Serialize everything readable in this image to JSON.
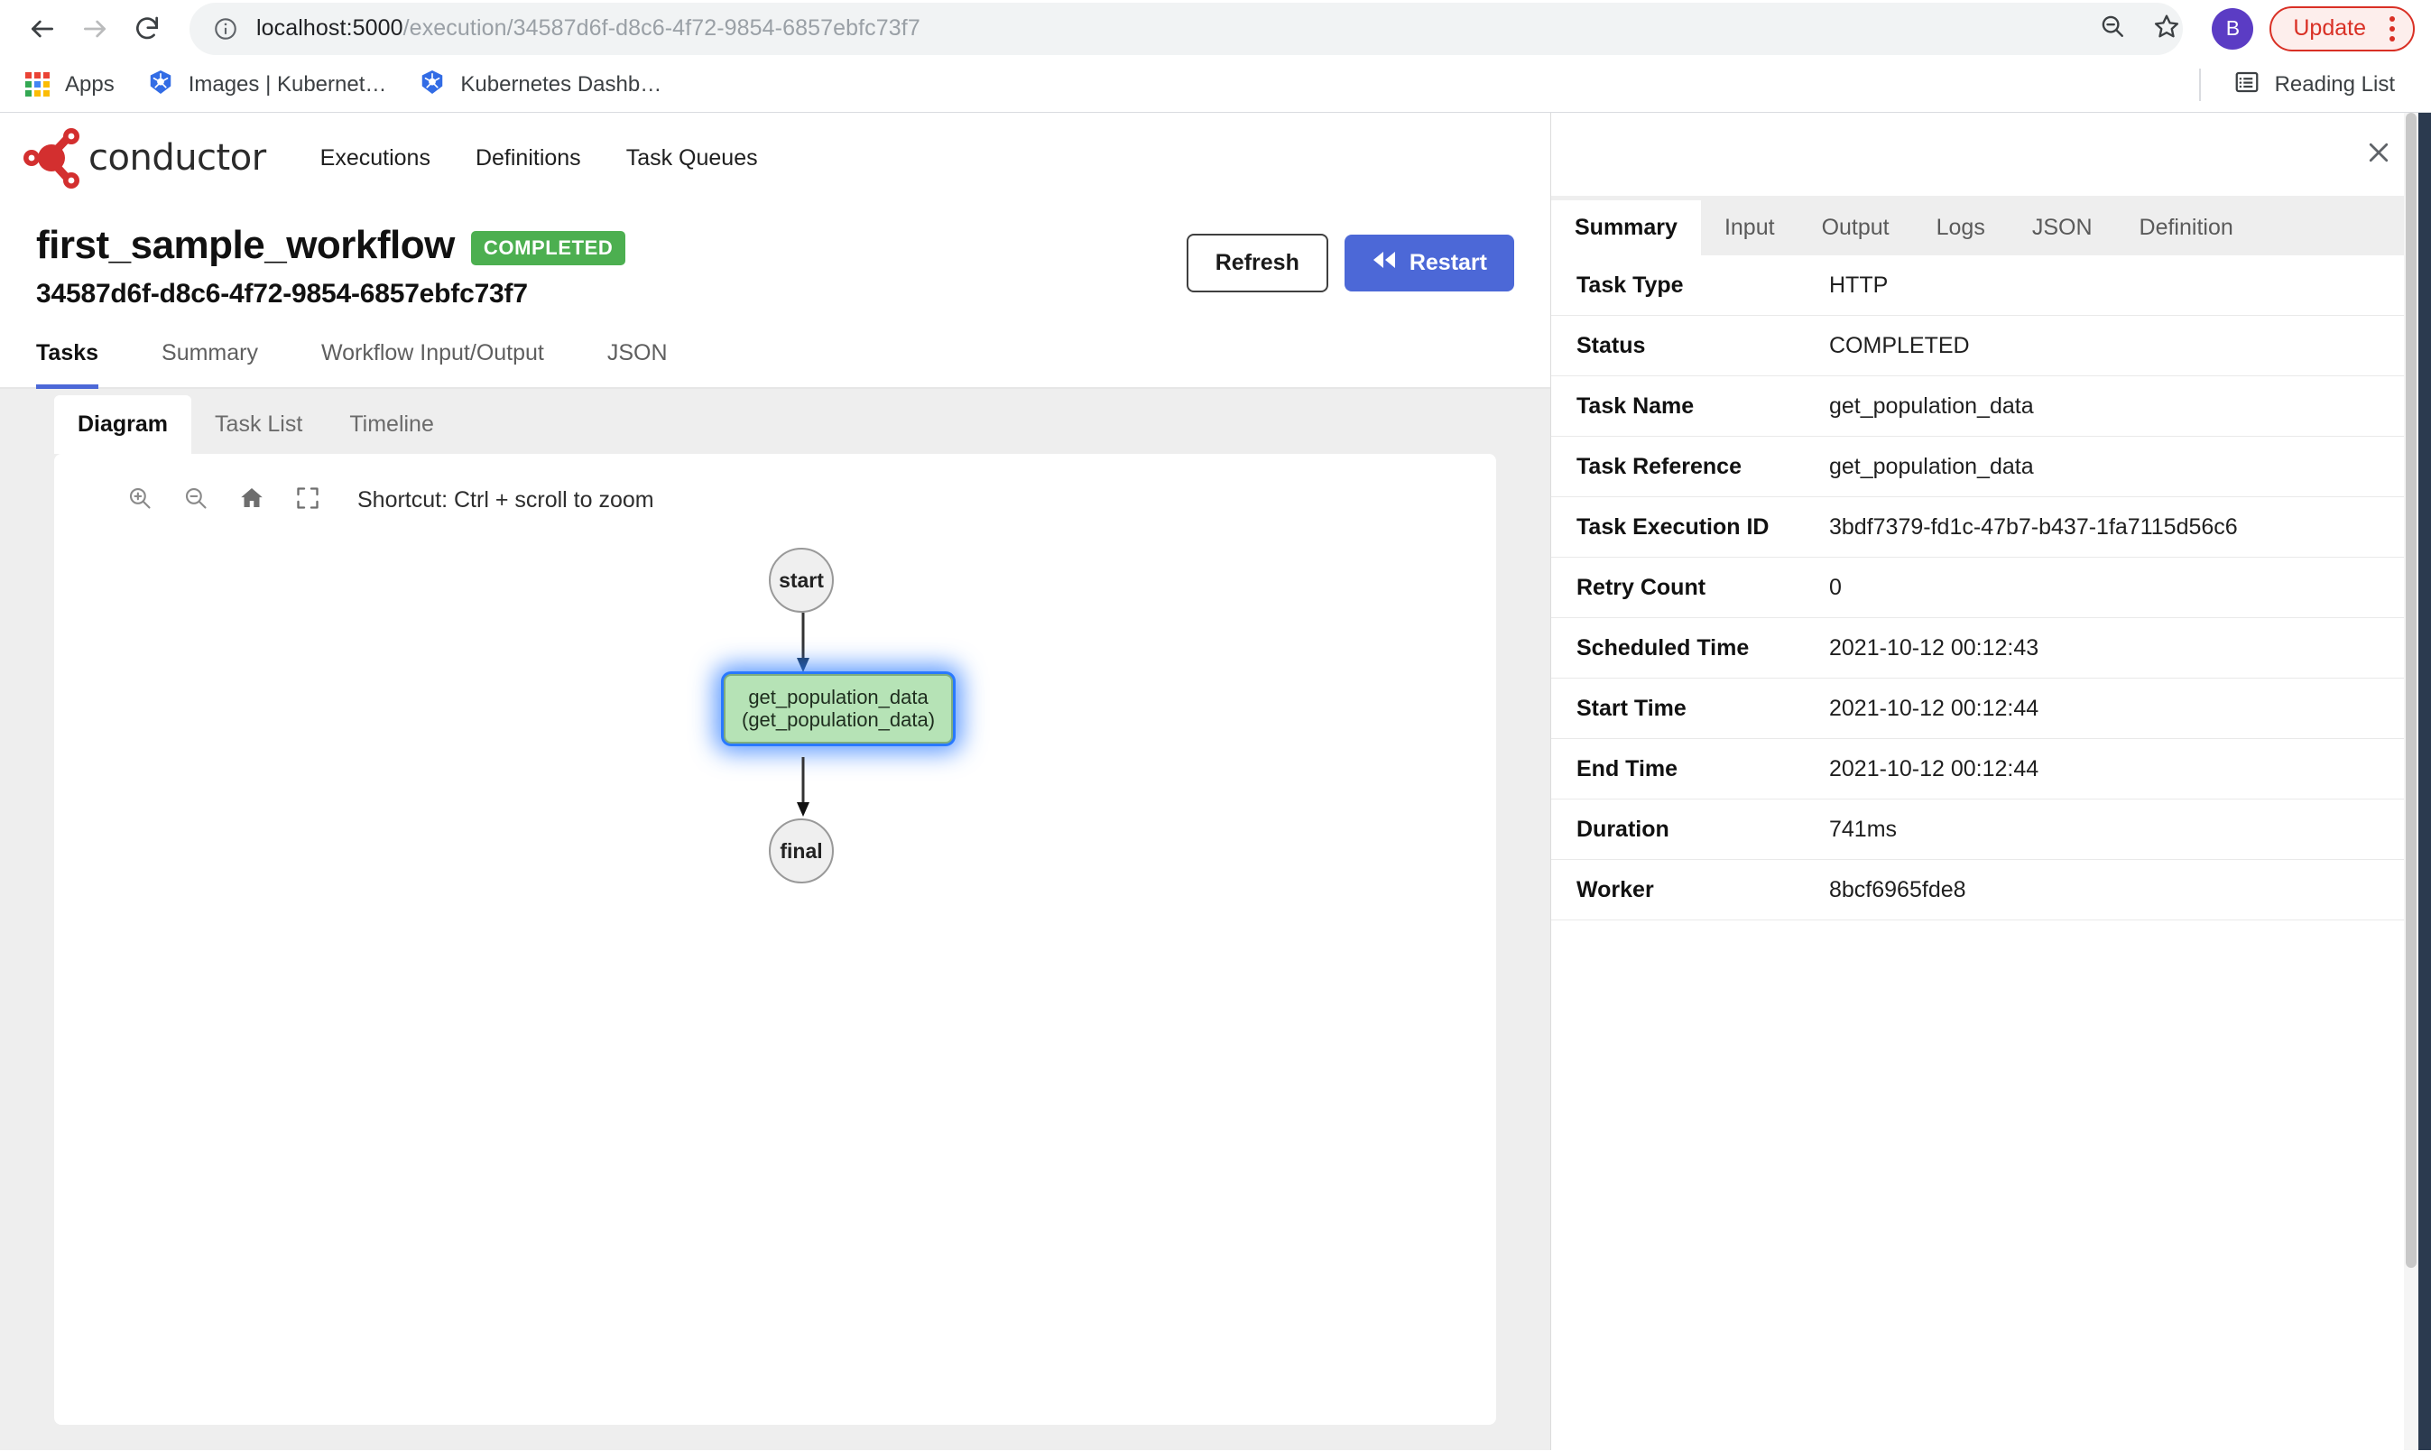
{
  "browser": {
    "url_host": "localhost:5000",
    "url_path": "/execution/34587d6f-d8c6-4f72-9854-6857ebfc73f7",
    "back_icon": "back-arrow-icon",
    "forward_icon": "forward-arrow-icon",
    "reload_icon": "reload-icon",
    "info_icon": "site-info-icon",
    "zoom_out_icon": "zoom-out-icon",
    "bookmark_icon": "bookmark-star-icon",
    "avatar_initial": "B",
    "avatar_color": "#5b3cc4",
    "update_label": "Update",
    "update_color": "#d93025",
    "menu_icon": "kebab-menu-icon",
    "bookmarks": [
      {
        "label": "Apps",
        "icon": "apps-grid-icon"
      },
      {
        "label": "Images | Kubernet…",
        "icon": "kubernetes-icon"
      },
      {
        "label": "Kubernetes Dashb…",
        "icon": "kubernetes-icon"
      }
    ],
    "reading_list_label": "Reading List",
    "reading_list_icon": "reading-list-icon"
  },
  "app": {
    "brand": "conductor",
    "brand_color": "#d32f2f",
    "nav": [
      {
        "label": "Executions"
      },
      {
        "label": "Definitions"
      },
      {
        "label": "Task Queues"
      }
    ]
  },
  "workflow": {
    "name": "first_sample_workflow",
    "status": "COMPLETED",
    "status_color": "#4caf50",
    "id": "34587d6f-d8c6-4f72-9854-6857ebfc73f7",
    "refresh_label": "Refresh",
    "restart_label": "Restart",
    "restart_icon": "rewind-icon",
    "tabs": [
      {
        "label": "Tasks",
        "active": true
      },
      {
        "label": "Summary",
        "active": false
      },
      {
        "label": "Workflow Input/Output",
        "active": false
      },
      {
        "label": "JSON",
        "active": false
      }
    ]
  },
  "tasks_panel": {
    "sub_tabs": [
      {
        "label": "Diagram",
        "active": true
      },
      {
        "label": "Task List",
        "active": false
      },
      {
        "label": "Timeline",
        "active": false
      }
    ],
    "toolbar": {
      "zoom_in_icon": "zoom-in-icon",
      "zoom_out_icon": "zoom-out-icon",
      "home_icon": "home-icon",
      "fullscreen_icon": "fullscreen-icon",
      "hint": "Shortcut: Ctrl + scroll to zoom"
    },
    "diagram": {
      "start_label": "start",
      "final_label": "final",
      "task_label_line1": "get_population_data",
      "task_label_line2": "(get_population_data)",
      "task_fill": "#b6e3b6",
      "task_selected_glow": "#2979ff"
    }
  },
  "drawer": {
    "close_icon": "close-icon",
    "tabs": [
      {
        "label": "Summary",
        "active": true
      },
      {
        "label": "Input",
        "active": false
      },
      {
        "label": "Output",
        "active": false
      },
      {
        "label": "Logs",
        "active": false
      },
      {
        "label": "JSON",
        "active": false
      },
      {
        "label": "Definition",
        "active": false
      }
    ],
    "summary_rows": [
      {
        "key": "Task Type",
        "value": "HTTP"
      },
      {
        "key": "Status",
        "value": "COMPLETED"
      },
      {
        "key": "Task Name",
        "value": "get_population_data"
      },
      {
        "key": "Task Reference",
        "value": "get_population_data"
      },
      {
        "key": "Task Execution ID",
        "value": "3bdf7379-fd1c-47b7-b437-1fa7115d56c6"
      },
      {
        "key": "Retry Count",
        "value": "0"
      },
      {
        "key": "Scheduled Time",
        "value": "2021-10-12 00:12:43"
      },
      {
        "key": "Start Time",
        "value": "2021-10-12 00:12:44"
      },
      {
        "key": "End Time",
        "value": "2021-10-12 00:12:44"
      },
      {
        "key": "Duration",
        "value": "741ms"
      },
      {
        "key": "Worker",
        "value": "8bcf6965fde8"
      }
    ]
  }
}
